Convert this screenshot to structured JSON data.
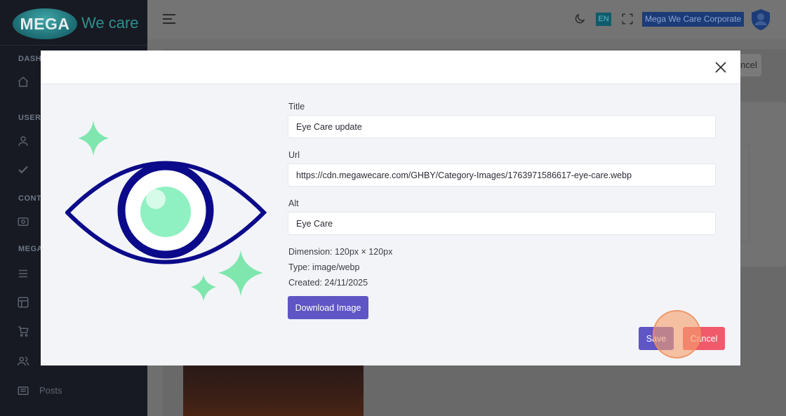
{
  "app": {
    "logo_mark": "MEGA",
    "logo_text": "We care"
  },
  "sidebar": {
    "section_labels": [
      "DASH",
      "USERS",
      "CONT",
      "MEGA"
    ],
    "bottom_item_label": "Posts"
  },
  "topbar": {
    "language": "EN",
    "user_name": "Mega We Care Corporate"
  },
  "background": {
    "edge_button_text": "ncel"
  },
  "modal": {
    "title_label": "Title",
    "title_value": "Eye Care update",
    "url_label": "Url",
    "url_value": "https://cdn.megawecare.com/GHBY/Category-Images/1763971586617-eye-care.webp",
    "alt_label": "Alt",
    "alt_value": "Eye Care",
    "dimension": "Dimension: 120px × 120px",
    "type": "Type: image/webp",
    "created": "Created: 24/11/2025",
    "download_label": "Download Image",
    "save_label": "Save",
    "cancel_label": "Cancel"
  },
  "colors": {
    "primary": "#5f55c4",
    "danger": "#f05a6b",
    "eye_outline": "#0b0a8a",
    "eye_iris": "#8ff0c2"
  }
}
